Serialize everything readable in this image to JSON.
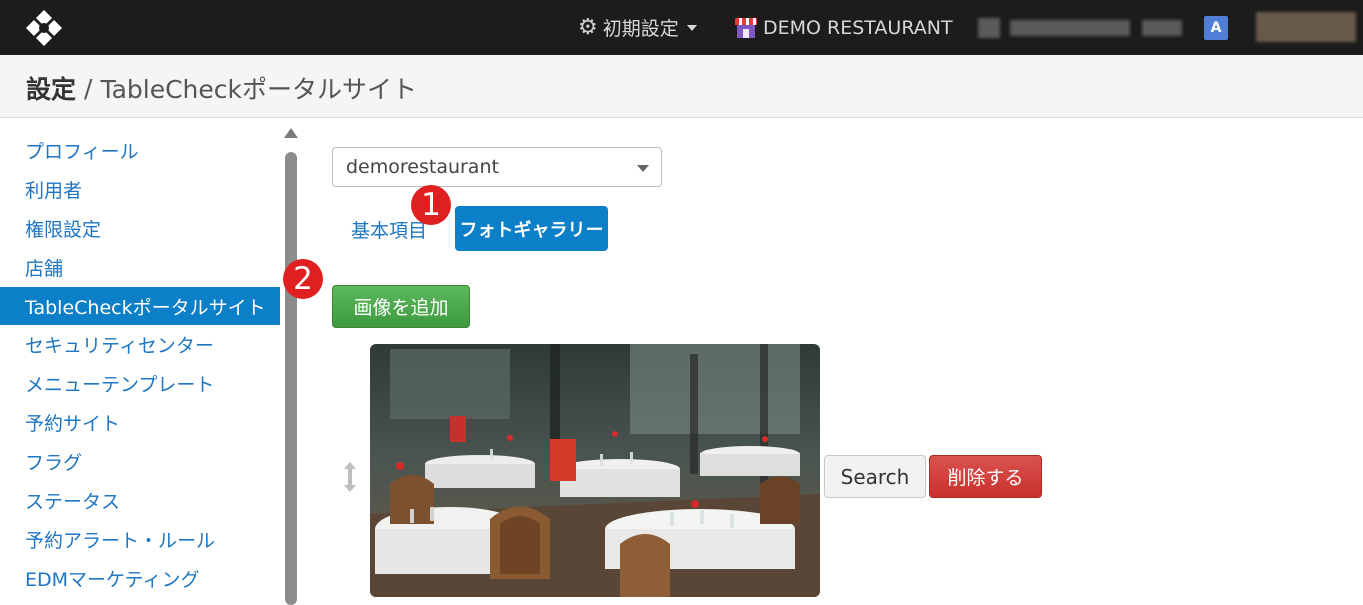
{
  "topbar": {
    "settings_label": "初期設定",
    "settings_icon": "gear-icon",
    "restaurant_name": "DEMO RESTAURANT",
    "restaurant_icon": "store-icon",
    "translate_icon_text": "A"
  },
  "breadcrumb": {
    "root": "設定",
    "separator": "/",
    "current": "TableCheckポータルサイト"
  },
  "sidebar": {
    "items": [
      {
        "label": "プロフィール",
        "active": false
      },
      {
        "label": "利用者",
        "active": false
      },
      {
        "label": "権限設定",
        "active": false
      },
      {
        "label": "店舗",
        "active": false
      },
      {
        "label": "TableCheckポータルサイト",
        "active": true
      },
      {
        "label": "セキュリティセンター",
        "active": false
      },
      {
        "label": "メニューテンプレート",
        "active": false
      },
      {
        "label": "予約サイト",
        "active": false
      },
      {
        "label": "フラグ",
        "active": false
      },
      {
        "label": "ステータス",
        "active": false
      },
      {
        "label": "予約アラート・ルール",
        "active": false
      },
      {
        "label": "EDMマーケティング",
        "active": false
      }
    ]
  },
  "main": {
    "shop_select": {
      "value": "demorestaurant"
    },
    "tabs": {
      "basic": "基本項目",
      "photo_gallery": "フォトギャラリー"
    },
    "add_image_label": "画像を追加",
    "gallery_item": {
      "search_label": "Search",
      "delete_label": "削除する"
    }
  },
  "annotations": {
    "marker_1": "1",
    "marker_2": "2"
  },
  "colors": {
    "topbar": "#1c1c1c",
    "accent": "#0b7fc7",
    "link": "#1f76c2",
    "add_button": "#4cae4c",
    "delete_button": "#d9534f",
    "marker": "#e02020"
  }
}
